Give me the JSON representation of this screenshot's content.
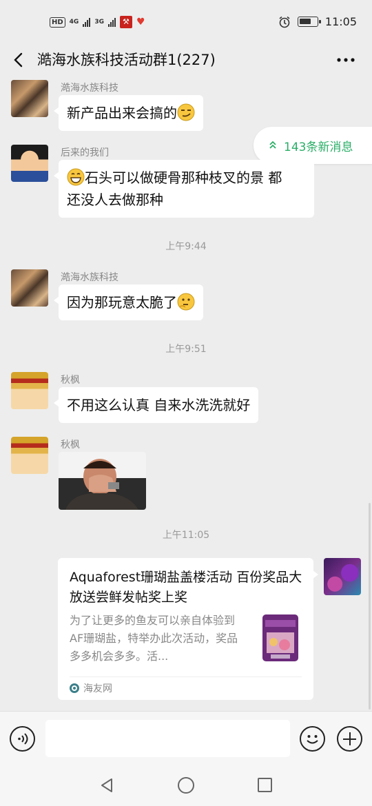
{
  "status_bar": {
    "hd_label": "HD",
    "sim1": "4G",
    "sim2": "3G",
    "time": "11:05",
    "battery_percent": 70
  },
  "header": {
    "title": "澔海水族科技活动群1(227)",
    "back_icon": "chevron-left-icon",
    "more_icon": "more-dots-icon"
  },
  "new_messages": {
    "label": "143条新消息",
    "icon": "double-chevron-up-icon",
    "color": "#2aae67"
  },
  "messages": [
    {
      "sender": "澔海水族科技",
      "text": "新产品出来会搞的",
      "emoji": "smirk-emoji"
    },
    {
      "sender": "后来的我们",
      "emoji": "grin-emoji",
      "line1": "石头可以做硬骨那种枝叉的景 都",
      "line2": "还没人去做那种"
    },
    {
      "sender": "澔海水族科技",
      "text": "因为那玩意太脆了",
      "emoji": "thinking-emoji"
    },
    {
      "sender": "秋枫",
      "text": "不用这么认真 自来水洗洗就好"
    },
    {
      "sender": "秋枫",
      "image": "facepalm-sticker"
    }
  ],
  "timestamps": [
    "上午9:44",
    "上午9:51",
    "上午11:05"
  ],
  "link_card": {
    "title": "Aquaforest珊瑚盐盖楼活动 百份奖品大放送尝鲜发帖奖上奖",
    "description": "为了让更多的鱼友可以亲自体验到AF珊瑚盐，特举办此次活动，奖品多多机会多多。活...",
    "source": "海友网",
    "thumbnail": "salt-bag-image"
  },
  "input_bar": {
    "placeholder": "",
    "voice_icon": "voice-icon",
    "emoji_icon": "emoji-icon",
    "plus_icon": "plus-icon"
  },
  "nav_bar": {
    "back_icon": "triangle-back-icon",
    "home_icon": "circle-home-icon",
    "recent_icon": "square-recent-icon"
  }
}
